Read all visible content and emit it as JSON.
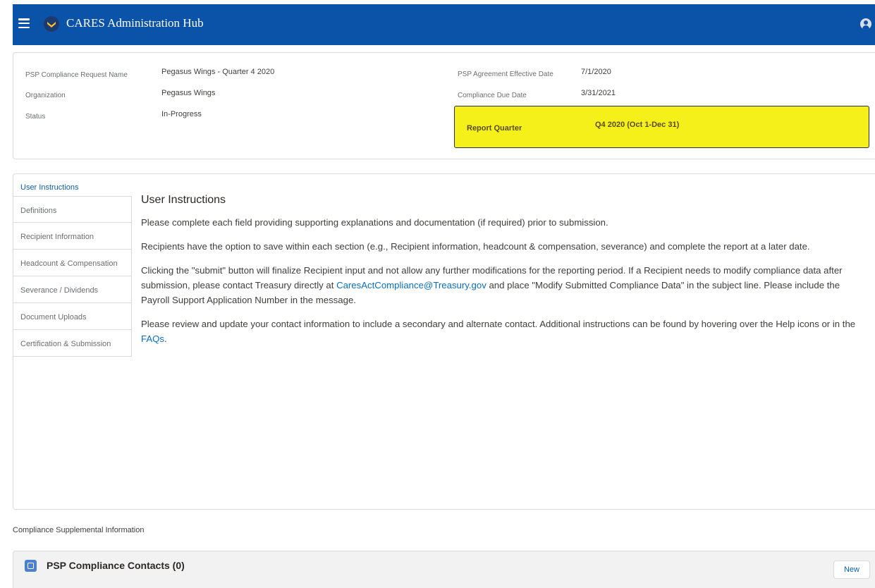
{
  "header": {
    "app_title": "CARES Administration Hub",
    "menu_icon": "hamburger-menu-icon",
    "logo_icon": "shield-chevron-logo",
    "avatar_icon": "user-avatar-icon",
    "bar_color": "#0a53a8"
  },
  "record": {
    "left_fields": [
      {
        "label": "PSP Compliance Request Name",
        "value": "Pegasus Wings - Quarter 4 2020"
      },
      {
        "label": "Organization",
        "value": "Pegasus Wings"
      },
      {
        "label": "Status",
        "value": "In-Progress"
      }
    ],
    "right_fields": [
      {
        "label": "PSP Agreement Effective Date",
        "value": "7/1/2020"
      },
      {
        "label": "Compliance Due Date",
        "value": "3/31/2021"
      }
    ],
    "report_quarter": {
      "label": "Report Quarter",
      "value": "Q4 2020 (Oct 1-Dec 31)",
      "highlight_color": "#f6f01a"
    }
  },
  "nav": {
    "items": [
      "User Instructions",
      "Definitions",
      "Recipient Information",
      "Headcount & Compensation",
      "Severance / Dividends",
      "Document Uploads",
      "Certification & Submission"
    ],
    "active": "User Instructions"
  },
  "instructions": {
    "title": "User Instructions",
    "p1": "Please complete each field providing supporting explanations and documentation (if required) prior to submission.",
    "p2": "Recipients have the option to save within each section (e.g., Recipient information, headcount & compensation, severance) and complete the report at a later date.",
    "p3_before": "Clicking the \"submit\" button will finalize Recipient input and not allow any further modifications for the reporting period. If a Recipient needs to modify compliance data after submission, please contact Treasury directly at ",
    "p3_link": "CaresActCompliance@Treasury.gov",
    "p3_after": " and place \"Modify Submitted Compliance Data\" in the subject line. Please include the Payroll Support Application Number in the message.",
    "p4_before": "Please review and update your contact information to include a secondary and alternate contact. Additional instructions can be found by hovering over the Help icons or in the ",
    "p4_link": "FAQs",
    "p4_after": "."
  },
  "supplemental": {
    "section_title": "Compliance Supplemental Information",
    "related_list": {
      "title": "PSP Compliance Contacts (0)",
      "icon": "contact-list-icon",
      "new_button": "New"
    }
  }
}
